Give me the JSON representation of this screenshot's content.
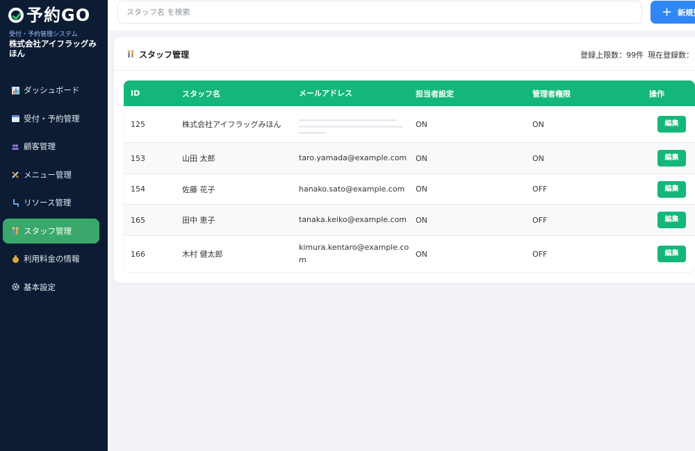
{
  "brand": {
    "logo_text": "予約GO",
    "subtitle": "受付・予約管理システム",
    "company": "株式会社アイフラッグみほん"
  },
  "sidebar": {
    "items": [
      {
        "label": "ダッシュボード",
        "icon": "bar-chart-icon"
      },
      {
        "label": "受付・予約管理",
        "icon": "calendar-icon"
      },
      {
        "label": "顧客管理",
        "icon": "users-icon"
      },
      {
        "label": "メニュー管理",
        "icon": "tools-icon"
      },
      {
        "label": "リソース管理",
        "icon": "chair-icon"
      },
      {
        "label": "スタッフ管理",
        "icon": "staff-icon",
        "active": true
      },
      {
        "label": "利用料金の情報",
        "icon": "money-bag-icon"
      },
      {
        "label": "基本設定",
        "icon": "gear-icon"
      }
    ]
  },
  "topbar": {
    "search_placeholder": "スタッフ名 を検索",
    "new_button": "新規登"
  },
  "page": {
    "title": "スタッフ管理",
    "limit_text": "登録上限数：99件",
    "current_text": "現在登録数："
  },
  "table": {
    "headers": [
      "ID",
      "スタッフ名",
      "メールアドレス",
      "担当者設定",
      "管理者権限",
      "操作"
    ],
    "rows": [
      {
        "id": "125",
        "name": "株式会社アイフラッグみほん",
        "email": "",
        "staff": "ON",
        "admin": "ON",
        "action": "編集"
      },
      {
        "id": "153",
        "name": "山田 太郎",
        "email": "taro.yamada@example.com",
        "staff": "ON",
        "admin": "ON",
        "action": "編集"
      },
      {
        "id": "154",
        "name": "佐藤 花子",
        "email": "hanako.sato@example.com",
        "staff": "ON",
        "admin": "OFF",
        "action": "編集"
      },
      {
        "id": "165",
        "name": "田中 恵子",
        "email": "tanaka.keiko@example.com",
        "staff": "ON",
        "admin": "OFF",
        "action": "編集"
      },
      {
        "id": "166",
        "name": "木村 健太郎",
        "email": "kimura.kentaro@example.com",
        "staff": "ON",
        "admin": "OFF",
        "action": "編集"
      }
    ]
  },
  "colors": {
    "sidebar_bg": "#0c1c33",
    "active_nav": "#3aa86a",
    "table_header": "#14b77a",
    "primary_button": "#2f86f5"
  }
}
